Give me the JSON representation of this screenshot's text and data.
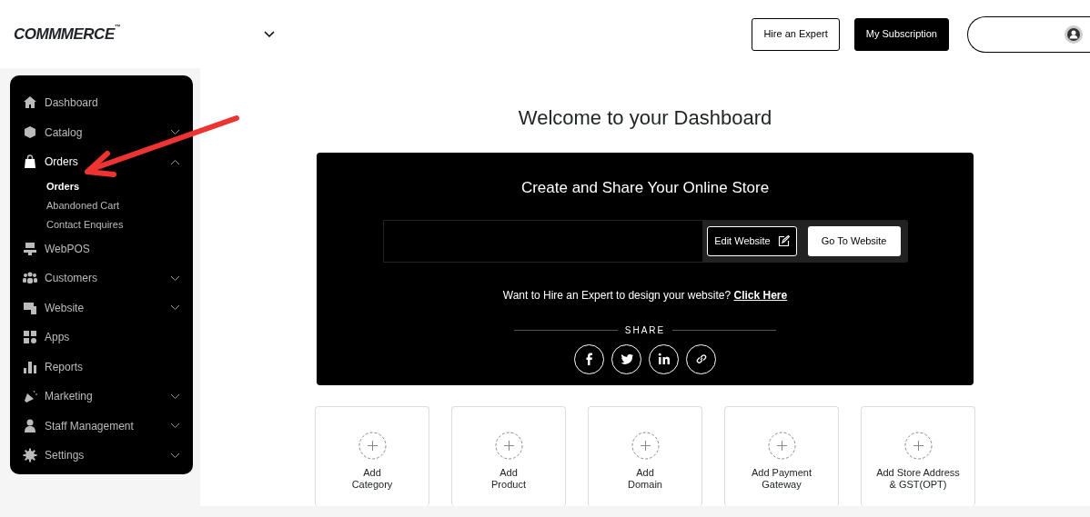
{
  "header": {
    "logo": "COMMMERCE",
    "trademark": "™",
    "buttons": [
      {
        "label": "Hire an Expert",
        "kind": "outline"
      },
      {
        "label": "My Subscription",
        "kind": "solid"
      }
    ]
  },
  "sidebar": {
    "items": [
      {
        "label": "Dashboard"
      },
      {
        "label": "Catalog",
        "expanded": false
      },
      {
        "label": "Orders",
        "expanded": true,
        "children": [
          {
            "label": "Orders",
            "selected": true
          },
          {
            "label": "Abandoned Cart",
            "selected": false
          },
          {
            "label": "Contact Enquires",
            "selected": false
          }
        ]
      },
      {
        "label": "WebPOS"
      },
      {
        "label": "Customers",
        "expanded": false
      },
      {
        "label": "Website",
        "expanded": false
      },
      {
        "label": "Apps"
      },
      {
        "label": "Reports"
      },
      {
        "label": "Marketing",
        "expanded": false
      },
      {
        "label": "Staff Management",
        "expanded": false
      },
      {
        "label": "Settings",
        "expanded": false
      }
    ]
  },
  "main": {
    "title": "Welcome to your Dashboard",
    "store_panel": {
      "title": "Create and Share Your Online Store",
      "edit_button": "Edit Website",
      "go_button": "Go To Website",
      "hire_text": "Want to Hire an Expert to design your website?",
      "hire_link": "Click Here",
      "share_label": "SHARE"
    },
    "cards": [
      {
        "label": "Add\nCategory"
      },
      {
        "label": "Add\nProduct"
      },
      {
        "label": "Add\nDomain"
      },
      {
        "label": "Add Payment\nGateway"
      },
      {
        "label": "Add Store Address\n& GST(OPT)"
      }
    ]
  }
}
